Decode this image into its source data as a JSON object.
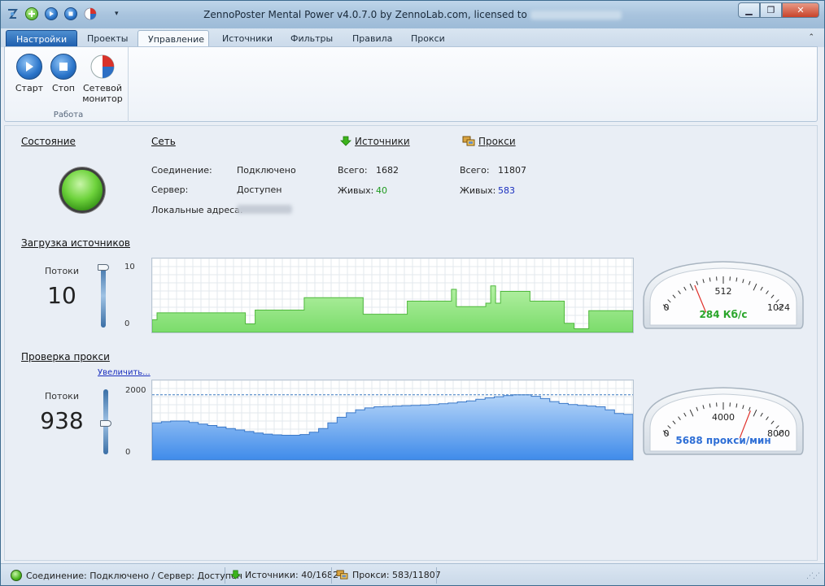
{
  "titlebar": {
    "title": "ZennoPoster Mental Power v4.0.7.0 by ZennoLab.com, licensed to",
    "minimize": "▁",
    "maximize": "❐",
    "close": "✕"
  },
  "tabs": [
    "Настройки",
    "Проекты",
    "Управление",
    "Источники",
    "Фильтры",
    "Правила",
    "Прокси"
  ],
  "ribbon": {
    "start": "Старт",
    "stop": "Стоп",
    "monitor_line1": "Сетевой",
    "monitor_line2": "монитор",
    "group": "Работа"
  },
  "state": {
    "title": "Состояние"
  },
  "network": {
    "title": "Сеть",
    "connection_label": "Соединение:",
    "connection_value": "Подключено",
    "server_label": "Сервер:",
    "server_value": "Доступен",
    "local_label": "Локальные адреса:"
  },
  "sources": {
    "title": "Источники",
    "total_label": "Всего:",
    "total_value": "1682",
    "alive_label": "Живых:",
    "alive_value": "40"
  },
  "proxy": {
    "title": "Прокси",
    "total_label": "Всего:",
    "total_value": "11807",
    "alive_label": "Живых:",
    "alive_value": "583"
  },
  "load_sources": {
    "title": "Загрузка источников",
    "threads_label": "Потоки",
    "threads_value": "10",
    "slider_max": "10",
    "slider_min": "0",
    "slider_level": 1.0,
    "gauge": {
      "min": "0",
      "mid": "512",
      "max": "1024",
      "value": 284,
      "range": 1024,
      "readout": "284 Кб/с",
      "color": "#2aa52a"
    }
  },
  "proxy_check": {
    "title": "Проверка прокси",
    "zoom_link": "Увеличить...",
    "threads_label": "Потоки",
    "threads_value": "938",
    "slider_max": "2000",
    "slider_min": "0",
    "slider_level": 0.47,
    "gauge": {
      "min": "0",
      "mid": "4000",
      "max": "8000",
      "value": 5688,
      "range": 8000,
      "readout": "5688 прокси/мин",
      "color": "#2f6fd6"
    }
  },
  "chart_data": [
    {
      "type": "area",
      "series": [
        {
          "values": [
            1.6,
            2.6,
            2.6,
            2.6,
            2.6,
            2.6,
            2.6,
            2.6,
            2.6,
            2.6,
            2.6,
            2.6,
            2.6,
            2.6,
            2.6,
            2.6,
            2.6,
            2.6,
            2.6,
            1.0,
            1.0,
            3.0,
            3.0,
            3.0,
            3.0,
            3.0,
            3.0,
            3.0,
            3.0,
            3.0,
            3.0,
            4.8,
            4.8,
            4.8,
            4.8,
            4.8,
            4.8,
            4.8,
            4.8,
            4.8,
            4.8,
            4.8,
            4.8,
            2.4,
            2.4,
            2.4,
            2.4,
            2.4,
            2.4,
            2.4,
            2.4,
            2.4,
            4.3,
            4.3,
            4.3,
            4.3,
            4.3,
            4.3,
            4.3,
            4.3,
            4.3,
            6.0,
            3.5,
            3.5,
            3.5,
            3.5,
            3.5,
            3.5,
            4.0,
            6.5,
            4.0,
            5.7,
            5.7,
            5.7,
            5.7,
            5.7,
            5.7,
            4.3,
            4.3,
            4.3,
            4.3,
            4.3,
            4.3,
            4.3,
            1.1,
            1.1,
            0.3,
            0.3,
            0.3,
            2.9,
            2.9,
            2.9,
            2.9,
            2.9,
            2.9,
            2.9,
            2.9,
            2.9
          ]
        }
      ],
      "ylim": [
        0,
        10
      ]
    },
    {
      "type": "area",
      "series": [
        {
          "values": [
            950,
            980,
            1000,
            1000,
            960,
            920,
            880,
            840,
            800,
            760,
            720,
            680,
            650,
            630,
            620,
            620,
            640,
            700,
            800,
            950,
            1100,
            1220,
            1300,
            1350,
            1380,
            1390,
            1400,
            1410,
            1420,
            1430,
            1440,
            1460,
            1480,
            1510,
            1540,
            1580,
            1620,
            1650,
            1680,
            1700,
            1700,
            1660,
            1600,
            1520,
            1470,
            1440,
            1420,
            1400,
            1380,
            1300,
            1200,
            1180
          ]
        }
      ],
      "ylim": [
        0,
        2000
      ]
    }
  ],
  "statusbar": {
    "connection": "Соединение: Подключено / Сервер: Доступен",
    "sources": "Источники: 40/1682",
    "proxy": "Прокси: 583/11807"
  }
}
